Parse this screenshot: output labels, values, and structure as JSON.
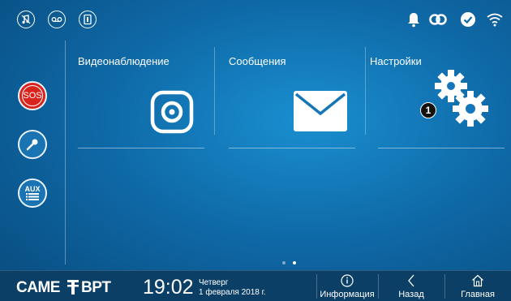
{
  "status_bar": {
    "left_icons": [
      "music-note-mute-icon",
      "voicemail-icon",
      "door-lock-icon"
    ],
    "right_icons": [
      "bell-icon",
      "link-icon",
      "check-circle-icon",
      "wifi-icon"
    ]
  },
  "sidebar": {
    "sos_label": "SOS",
    "key_icon": "key-icon",
    "aux_label": "AUX"
  },
  "tiles": [
    {
      "label": "Видеонаблюдение",
      "icon": "camera-icon"
    },
    {
      "label": "Сообщения",
      "icon": "envelope-icon"
    },
    {
      "label": "Настройки",
      "icon": "gears-icon",
      "badge": "1"
    }
  ],
  "pager": {
    "pages": 2,
    "active": 2
  },
  "bottom_bar": {
    "brand_came": "CAME",
    "brand_bpt": "BPT",
    "time": "19:02",
    "weekday": "Четверг",
    "date": "1 февраля 2018 г.",
    "info_label": "Информация",
    "back_label": "Назад",
    "home_label": "Главная"
  },
  "colors": {
    "accent": "#1a8fd0",
    "sos_red": "#d9231d",
    "bar": "#0b3f66"
  }
}
